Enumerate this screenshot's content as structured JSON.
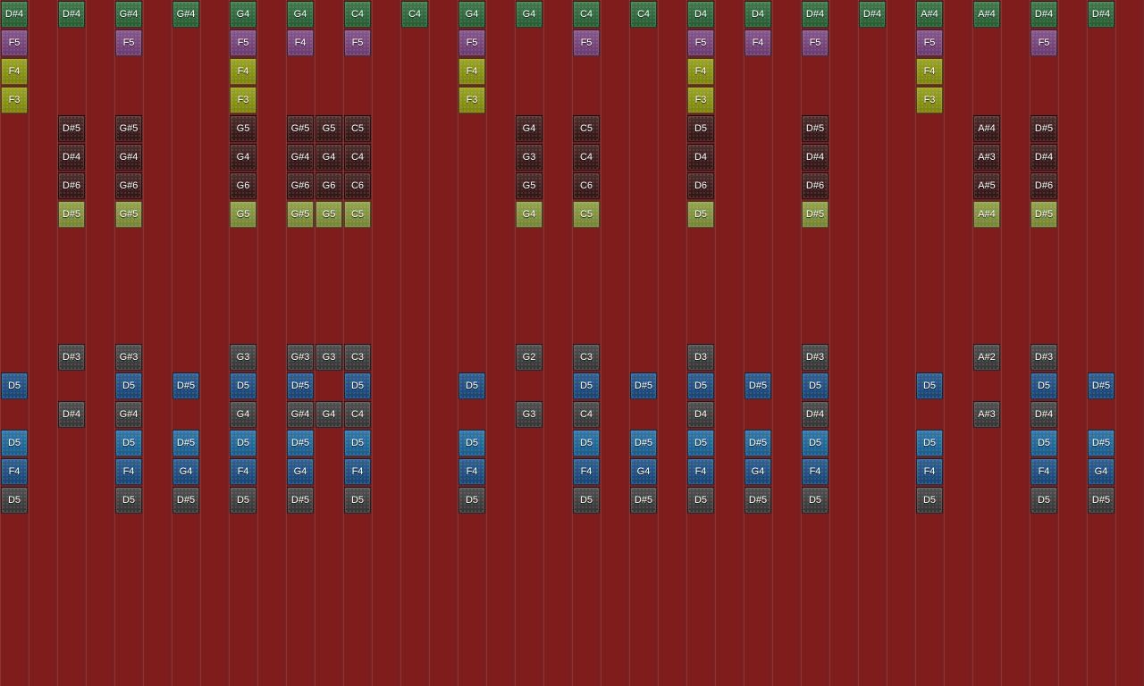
{
  "colors": {
    "green": "#2c6b3a",
    "purple": "#7b4480",
    "yellow": "#8e9a10",
    "dark": "#3a1717",
    "lime": "#879a3c",
    "gray": "#3e3e3e",
    "blue": "#1b4f86",
    "teal": "#1e6aa0"
  },
  "rows": [
    {
      "name": "row-1",
      "style": "green",
      "notes": [
        {
          "col": 0,
          "label": "D#4"
        },
        {
          "col": 2,
          "label": "D#4"
        },
        {
          "col": 4,
          "label": "G#4"
        },
        {
          "col": 6,
          "label": "G#4"
        },
        {
          "col": 8,
          "label": "G4"
        },
        {
          "col": 10,
          "label": "G4"
        },
        {
          "col": 12,
          "label": "C4"
        },
        {
          "col": 14,
          "label": "C4"
        },
        {
          "col": 16,
          "label": "G4"
        },
        {
          "col": 18,
          "label": "G4"
        },
        {
          "col": 20,
          "label": "C4"
        },
        {
          "col": 22,
          "label": "C4"
        },
        {
          "col": 24,
          "label": "D4"
        },
        {
          "col": 26,
          "label": "D4"
        },
        {
          "col": 28,
          "label": "D#4"
        },
        {
          "col": 30,
          "label": "D#4"
        },
        {
          "col": 32,
          "label": "A#4"
        },
        {
          "col": 34,
          "label": "A#4"
        },
        {
          "col": 36,
          "label": "D#4"
        },
        {
          "col": 38,
          "label": "D#4"
        }
      ]
    },
    {
      "name": "row-2",
      "style": "purple",
      "notes": [
        {
          "col": 0,
          "label": "F5"
        },
        {
          "col": 4,
          "label": "F5"
        },
        {
          "col": 8,
          "label": "F5"
        },
        {
          "col": 10,
          "label": "F4"
        },
        {
          "col": 12,
          "label": "F5"
        },
        {
          "col": 16,
          "label": "F5"
        },
        {
          "col": 20,
          "label": "F5"
        },
        {
          "col": 24,
          "label": "F5"
        },
        {
          "col": 26,
          "label": "F4"
        },
        {
          "col": 28,
          "label": "F5"
        },
        {
          "col": 32,
          "label": "F5"
        },
        {
          "col": 36,
          "label": "F5"
        }
      ]
    },
    {
      "name": "row-3",
      "style": "yellow",
      "notes": [
        {
          "col": 0,
          "label": "F4"
        },
        {
          "col": 8,
          "label": "F4"
        },
        {
          "col": 16,
          "label": "F4"
        },
        {
          "col": 24,
          "label": "F4"
        },
        {
          "col": 32,
          "label": "F4"
        }
      ]
    },
    {
      "name": "row-4",
      "style": "yellow",
      "notes": [
        {
          "col": 0,
          "label": "F3"
        },
        {
          "col": 8,
          "label": "F3"
        },
        {
          "col": 16,
          "label": "F3"
        },
        {
          "col": 24,
          "label": "F3"
        },
        {
          "col": 32,
          "label": "F3"
        }
      ]
    },
    {
      "name": "row-5",
      "style": "dark",
      "notes": [
        {
          "col": 2,
          "label": "D#5"
        },
        {
          "col": 4,
          "label": "G#5"
        },
        {
          "col": 8,
          "label": "G5"
        },
        {
          "col": 10,
          "label": "G#5"
        },
        {
          "col": 11,
          "label": "G5"
        },
        {
          "col": 12,
          "label": "C5"
        },
        {
          "col": 18,
          "label": "G4"
        },
        {
          "col": 20,
          "label": "C5"
        },
        {
          "col": 24,
          "label": "D5"
        },
        {
          "col": 28,
          "label": "D#5"
        },
        {
          "col": 34,
          "label": "A#4"
        },
        {
          "col": 36,
          "label": "D#5"
        }
      ]
    },
    {
      "name": "row-6",
      "style": "dark",
      "notes": [
        {
          "col": 2,
          "label": "D#4"
        },
        {
          "col": 4,
          "label": "G#4"
        },
        {
          "col": 8,
          "label": "G4"
        },
        {
          "col": 10,
          "label": "G#4"
        },
        {
          "col": 11,
          "label": "G4"
        },
        {
          "col": 12,
          "label": "C4"
        },
        {
          "col": 18,
          "label": "G3"
        },
        {
          "col": 20,
          "label": "C4"
        },
        {
          "col": 24,
          "label": "D4"
        },
        {
          "col": 28,
          "label": "D#4"
        },
        {
          "col": 34,
          "label": "A#3"
        },
        {
          "col": 36,
          "label": "D#4"
        }
      ]
    },
    {
      "name": "row-7",
      "style": "dark",
      "notes": [
        {
          "col": 2,
          "label": "D#6"
        },
        {
          "col": 4,
          "label": "G#6"
        },
        {
          "col": 8,
          "label": "G6"
        },
        {
          "col": 10,
          "label": "G#6"
        },
        {
          "col": 11,
          "label": "G6"
        },
        {
          "col": 12,
          "label": "C6"
        },
        {
          "col": 18,
          "label": "G5"
        },
        {
          "col": 20,
          "label": "C6"
        },
        {
          "col": 24,
          "label": "D6"
        },
        {
          "col": 28,
          "label": "D#6"
        },
        {
          "col": 34,
          "label": "A#5"
        },
        {
          "col": 36,
          "label": "D#6"
        }
      ]
    },
    {
      "name": "row-8",
      "style": "lime",
      "notes": [
        {
          "col": 2,
          "label": "D#5"
        },
        {
          "col": 4,
          "label": "G#5"
        },
        {
          "col": 8,
          "label": "G5"
        },
        {
          "col": 10,
          "label": "G#5"
        },
        {
          "col": 11,
          "label": "G5"
        },
        {
          "col": 12,
          "label": "C5"
        },
        {
          "col": 18,
          "label": "G4"
        },
        {
          "col": 20,
          "label": "C5"
        },
        {
          "col": 24,
          "label": "D5"
        },
        {
          "col": 28,
          "label": "D#5"
        },
        {
          "col": 34,
          "label": "A#4"
        },
        {
          "col": 36,
          "label": "D#5"
        }
      ]
    },
    {
      "name": "row-9",
      "style": "gray",
      "notes": []
    },
    {
      "name": "row-10",
      "style": "gray",
      "notes": []
    },
    {
      "name": "row-11",
      "style": "gray",
      "notes": []
    },
    {
      "name": "row-12",
      "style": "gray",
      "notes": []
    },
    {
      "name": "row-13",
      "style": "gray",
      "notes": [
        {
          "col": 2,
          "label": "D#3"
        },
        {
          "col": 4,
          "label": "G#3"
        },
        {
          "col": 8,
          "label": "G3"
        },
        {
          "col": 10,
          "label": "G#3"
        },
        {
          "col": 11,
          "label": "G3"
        },
        {
          "col": 12,
          "label": "C3"
        },
        {
          "col": 18,
          "label": "G2"
        },
        {
          "col": 20,
          "label": "C3"
        },
        {
          "col": 24,
          "label": "D3"
        },
        {
          "col": 28,
          "label": "D#3"
        },
        {
          "col": 34,
          "label": "A#2"
        },
        {
          "col": 36,
          "label": "D#3"
        }
      ]
    },
    {
      "name": "row-14",
      "style": "blue",
      "notes": [
        {
          "col": 0,
          "label": "D5"
        },
        {
          "col": 4,
          "label": "D5"
        },
        {
          "col": 6,
          "label": "D#5"
        },
        {
          "col": 8,
          "label": "D5"
        },
        {
          "col": 10,
          "label": "D#5"
        },
        {
          "col": 12,
          "label": "D5"
        },
        {
          "col": 16,
          "label": "D5"
        },
        {
          "col": 20,
          "label": "D5"
        },
        {
          "col": 22,
          "label": "D#5"
        },
        {
          "col": 24,
          "label": "D5"
        },
        {
          "col": 26,
          "label": "D#5"
        },
        {
          "col": 28,
          "label": "D5"
        },
        {
          "col": 32,
          "label": "D5"
        },
        {
          "col": 36,
          "label": "D5"
        },
        {
          "col": 38,
          "label": "D#5"
        }
      ]
    },
    {
      "name": "row-15",
      "style": "gray",
      "notes": [
        {
          "col": 2,
          "label": "D#4"
        },
        {
          "col": 4,
          "label": "G#4"
        },
        {
          "col": 8,
          "label": "G4"
        },
        {
          "col": 10,
          "label": "G#4"
        },
        {
          "col": 11,
          "label": "G4"
        },
        {
          "col": 12,
          "label": "C4"
        },
        {
          "col": 18,
          "label": "G3"
        },
        {
          "col": 20,
          "label": "C4"
        },
        {
          "col": 24,
          "label": "D4"
        },
        {
          "col": 28,
          "label": "D#4"
        },
        {
          "col": 34,
          "label": "A#3"
        },
        {
          "col": 36,
          "label": "D#4"
        }
      ]
    },
    {
      "name": "row-16",
      "style": "teal",
      "notes": [
        {
          "col": 0,
          "label": "D5"
        },
        {
          "col": 4,
          "label": "D5"
        },
        {
          "col": 6,
          "label": "D#5"
        },
        {
          "col": 8,
          "label": "D5"
        },
        {
          "col": 10,
          "label": "D#5"
        },
        {
          "col": 12,
          "label": "D5"
        },
        {
          "col": 16,
          "label": "D5"
        },
        {
          "col": 20,
          "label": "D5"
        },
        {
          "col": 22,
          "label": "D#5"
        },
        {
          "col": 24,
          "label": "D5"
        },
        {
          "col": 26,
          "label": "D#5"
        },
        {
          "col": 28,
          "label": "D5"
        },
        {
          "col": 32,
          "label": "D5"
        },
        {
          "col": 36,
          "label": "D5"
        },
        {
          "col": 38,
          "label": "D#5"
        }
      ]
    },
    {
      "name": "row-17",
      "style": "blue",
      "notes": [
        {
          "col": 0,
          "label": "F4"
        },
        {
          "col": 4,
          "label": "F4"
        },
        {
          "col": 6,
          "label": "G4"
        },
        {
          "col": 8,
          "label": "F4"
        },
        {
          "col": 10,
          "label": "G4"
        },
        {
          "col": 12,
          "label": "F4"
        },
        {
          "col": 16,
          "label": "F4"
        },
        {
          "col": 20,
          "label": "F4"
        },
        {
          "col": 22,
          "label": "G4"
        },
        {
          "col": 24,
          "label": "F4"
        },
        {
          "col": 26,
          "label": "G4"
        },
        {
          "col": 28,
          "label": "F4"
        },
        {
          "col": 32,
          "label": "F4"
        },
        {
          "col": 36,
          "label": "F4"
        },
        {
          "col": 38,
          "label": "G4"
        }
      ]
    },
    {
      "name": "row-18",
      "style": "gray",
      "notes": [
        {
          "col": 0,
          "label": "D5"
        },
        {
          "col": 4,
          "label": "D5"
        },
        {
          "col": 6,
          "label": "D#5"
        },
        {
          "col": 8,
          "label": "D5"
        },
        {
          "col": 10,
          "label": "D#5"
        },
        {
          "col": 12,
          "label": "D5"
        },
        {
          "col": 16,
          "label": "D5"
        },
        {
          "col": 20,
          "label": "D5"
        },
        {
          "col": 22,
          "label": "D#5"
        },
        {
          "col": 24,
          "label": "D5"
        },
        {
          "col": 26,
          "label": "D#5"
        },
        {
          "col": 28,
          "label": "D5"
        },
        {
          "col": 32,
          "label": "D5"
        },
        {
          "col": 36,
          "label": "D5"
        },
        {
          "col": 38,
          "label": "D#5"
        }
      ]
    }
  ]
}
